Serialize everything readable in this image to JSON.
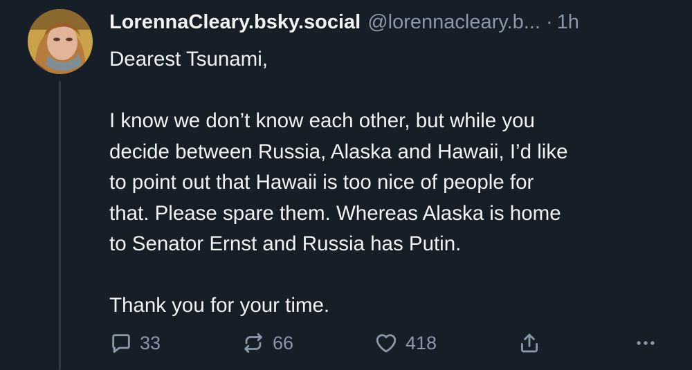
{
  "post": {
    "display_name": "LorennaCleary.bsky.social",
    "handle": "@lorennacleary.b...",
    "separator": "·",
    "timestamp": "1h",
    "body_lines": [
      "Dearest Tsunami,",
      "",
      "I know we don’t know each other, but while you",
      "decide between Russia, Alaska and Hawaii, I’d like",
      "to point out that Hawaii is too nice of people for",
      "that. Please spare them. Whereas Alaska is home",
      "to Senator Ernst and Russia has Putin.",
      "",
      "Thank you for your time."
    ]
  },
  "actions": {
    "reply": {
      "icon": "reply-icon",
      "count": "33"
    },
    "repost": {
      "icon": "repost-icon",
      "count": "66"
    },
    "like": {
      "icon": "heart-icon",
      "count": "418"
    },
    "share": {
      "icon": "share-icon"
    },
    "more": {
      "icon": "more-icon"
    }
  },
  "colors": {
    "background": "#161e27",
    "text": "#f1f3f5",
    "muted": "#8b98a9",
    "thread_line": "#2f3a47"
  }
}
